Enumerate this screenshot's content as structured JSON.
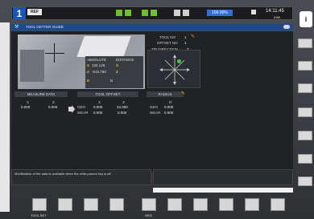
{
  "header": {
    "channel": "1",
    "mode": "REF",
    "feed_badge": "100.00%",
    "clock": "14:11:45",
    "brand": "iHMI"
  },
  "title_bar": {
    "title": "TOOL GETTER GUIDE"
  },
  "camera": {
    "absolute_label": "ABSOLUTE",
    "distance_label": "DISTANCE",
    "axes": [
      {
        "axis": "X",
        "absolute": "226.128",
        "distance": "X"
      },
      {
        "axis": "Z",
        "absolute": "-619.780",
        "distance": "Z"
      }
    ],
    "extra_left": "D",
    "extra_right": "B"
  },
  "tool_info": {
    "tool_no_label": "TOOL NO",
    "tool_no_value": "1",
    "offset_no_label": "OFFSET NO",
    "offset_no_value": "1",
    "tip_direction_label": "TIP DIRECTION",
    "tip_direction_value": "3"
  },
  "sections": {
    "measure_data": "MEASURE DATA",
    "tool_offset": "TOOL OFFSET",
    "radius": "RADIUS"
  },
  "measure": {
    "x_label": "X",
    "x_value": "0.000",
    "z_label": "Z",
    "z_value": "0.000"
  },
  "offset": {
    "geo_label": "GEO",
    "wear_label": "WEAR",
    "x_label": "X",
    "x_geo": "0.000",
    "x_wear": "0.000",
    "z_label": "Z",
    "z_geo": "34.000",
    "z_wear": "0.000"
  },
  "radius": {
    "geo_label": "GEO",
    "wear_label": "WEAR",
    "r_label": "R",
    "r_geo": "0.000",
    "r_wear": "0.000"
  },
  "message": "Modification of the data is available when the write-protect key is off.",
  "bottom_keys": [
    {
      "label": "TOOL SET"
    },
    {
      "label": ""
    },
    {
      "label": ""
    },
    {
      "label": ""
    },
    {
      "label": "GEO"
    },
    {
      "label": ""
    },
    {
      "label": ""
    },
    {
      "label": ""
    },
    {
      "label": ""
    },
    {
      "label": ""
    }
  ],
  "colors": {
    "accent": "#1a56b8",
    "title_bar": "#1d4a8a",
    "warning": "#f0c030",
    "ok": "#3fcf3f"
  }
}
